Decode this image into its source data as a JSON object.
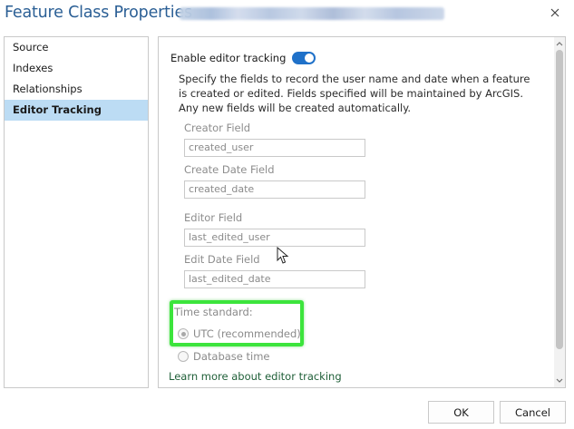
{
  "window": {
    "title": "Feature Class Properties"
  },
  "nav": {
    "items": [
      {
        "label": "Source"
      },
      {
        "label": "Indexes"
      },
      {
        "label": "Relationships"
      },
      {
        "label": "Editor Tracking",
        "selected": true
      }
    ]
  },
  "editor_tracking": {
    "toggle_label": "Enable editor tracking",
    "toggle_on": true,
    "description": "Specify the fields to record the user name and date when a feature is created or edited. Fields specified will be maintained by ArcGIS. Any new fields will be created automatically.",
    "creator_field": {
      "label": "Creator Field",
      "value": "created_user"
    },
    "create_date_field": {
      "label": "Create Date Field",
      "value": "created_date"
    },
    "editor_field": {
      "label": "Editor Field",
      "value": "last_edited_user"
    },
    "edit_date_field": {
      "label": "Edit Date Field",
      "value": "last_edited_date"
    },
    "time_standard_label": "Time standard:",
    "utc_option": {
      "label": "UTC (recommended)",
      "checked": true
    },
    "database_option": {
      "label": "Database time",
      "checked": false
    },
    "learn_more": "Learn more about editor tracking"
  },
  "buttons": {
    "ok": "OK",
    "cancel": "Cancel"
  },
  "colors": {
    "title": "#2b5f95",
    "selection": "#bcdcf4",
    "toggle": "#1f71c9",
    "highlight": "#3ce43c",
    "link": "#1f5f38"
  },
  "icons": {
    "close": "close-icon",
    "cursor": "mouse-pointer-icon",
    "scroll_up": "chevron-up-icon",
    "scroll_down": "chevron-down-icon"
  }
}
